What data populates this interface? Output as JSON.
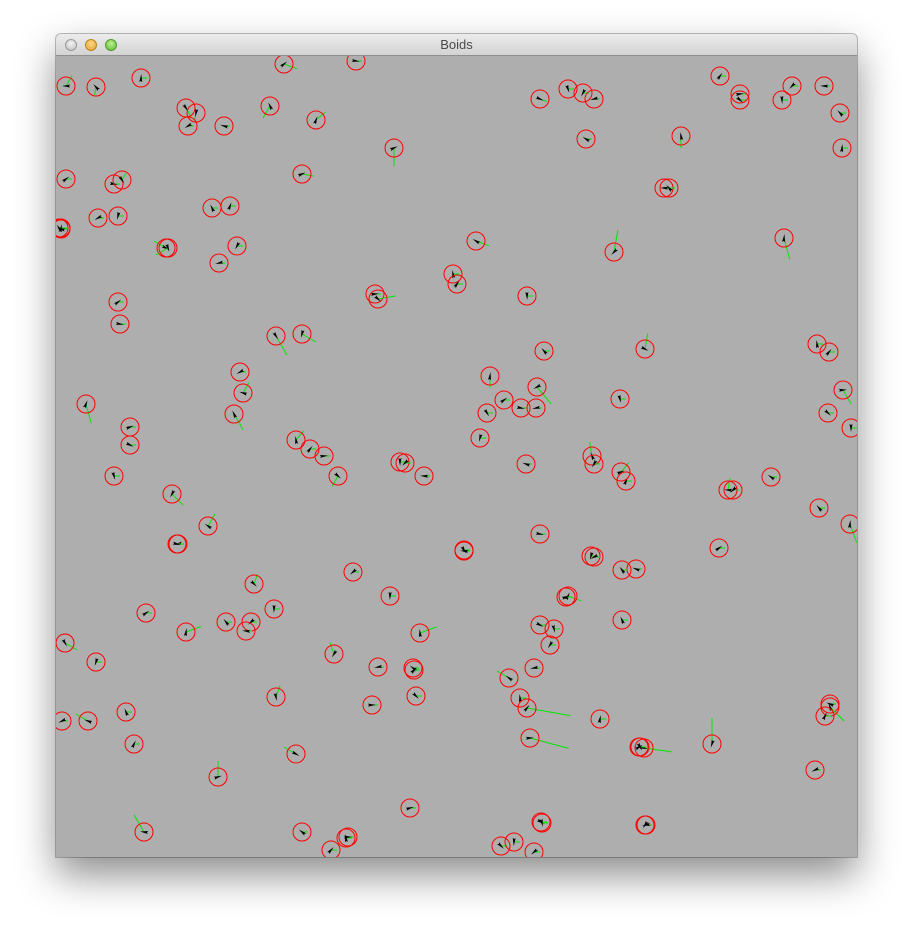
{
  "window": {
    "title": "Boids"
  },
  "colors": {
    "background": "#aeaeae",
    "boid_body": "#000000",
    "perception_ring": "#ff0000",
    "velocity_vector": "#00e600"
  },
  "icons": {
    "close": "close-button-icon",
    "minimize": "minimize-button-icon",
    "zoom": "zoom-button-icon",
    "boid": "boid-arrow-icon"
  }
}
